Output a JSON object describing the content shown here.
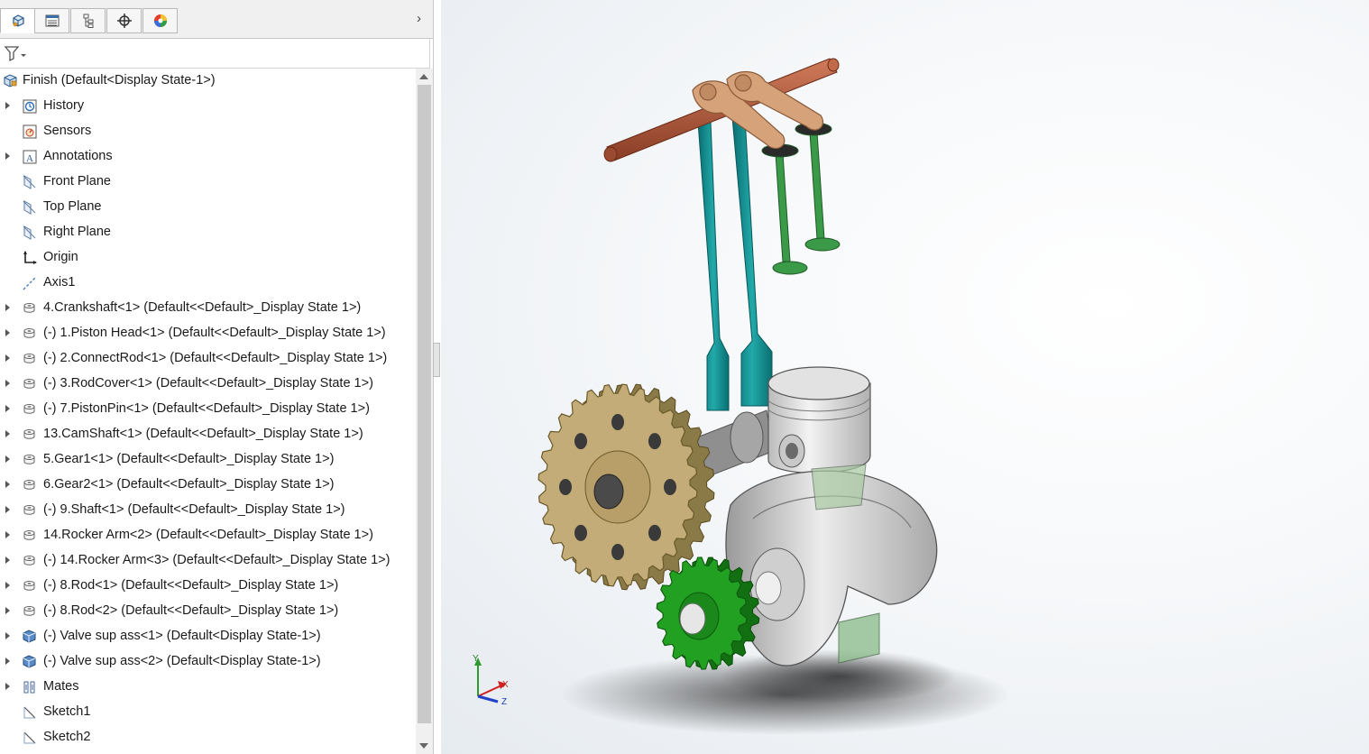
{
  "tabs": [
    {
      "name": "feature-manager",
      "icon": "part-cube-icon"
    },
    {
      "name": "property-manager",
      "icon": "list-icon"
    },
    {
      "name": "configuration-manager",
      "icon": "config-tree-icon"
    },
    {
      "name": "dimxpert-manager",
      "icon": "crosshair-icon"
    },
    {
      "name": "display-manager",
      "icon": "color-wheel-icon"
    }
  ],
  "filter": {
    "icon": "filter-icon"
  },
  "tree": {
    "root": {
      "label": "Finish  (Default<Display State-1>)",
      "icon": "assembly-icon"
    },
    "items": [
      {
        "label": "History",
        "icon": "history-icon",
        "expand": true
      },
      {
        "label": "Sensors",
        "icon": "sensor-icon",
        "expand": false
      },
      {
        "label": "Annotations",
        "icon": "annotation-icon",
        "expand": true
      },
      {
        "label": "Front Plane",
        "icon": "plane-icon",
        "expand": false
      },
      {
        "label": "Top Plane",
        "icon": "plane-icon",
        "expand": false
      },
      {
        "label": "Right Plane",
        "icon": "plane-icon",
        "expand": false
      },
      {
        "label": "Origin",
        "icon": "origin-icon",
        "expand": false
      },
      {
        "label": "Axis1",
        "icon": "axis-icon",
        "expand": false
      },
      {
        "label": "4.Crankshaft<1> (Default<<Default>_Display State 1>)",
        "icon": "part-icon",
        "expand": true
      },
      {
        "label": "(-) 1.Piston Head<1> (Default<<Default>_Display State 1>)",
        "icon": "part-icon",
        "expand": true
      },
      {
        "label": "(-) 2.ConnectRod<1> (Default<<Default>_Display State 1>)",
        "icon": "part-icon",
        "expand": true
      },
      {
        "label": "(-) 3.RodCover<1> (Default<<Default>_Display State 1>)",
        "icon": "part-icon",
        "expand": true
      },
      {
        "label": "(-) 7.PistonPin<1> (Default<<Default>_Display State 1>)",
        "icon": "part-icon",
        "expand": true
      },
      {
        "label": "13.CamShaft<1> (Default<<Default>_Display State 1>)",
        "icon": "part-icon",
        "expand": true
      },
      {
        "label": "5.Gear1<1> (Default<<Default>_Display State 1>)",
        "icon": "part-icon",
        "expand": true
      },
      {
        "label": "6.Gear2<1> (Default<<Default>_Display State 1>)",
        "icon": "part-icon",
        "expand": true
      },
      {
        "label": "(-) 9.Shaft<1> (Default<<Default>_Display State 1>)",
        "icon": "part-icon",
        "expand": true
      },
      {
        "label": "14.Rocker Arm<2> (Default<<Default>_Display State 1>)",
        "icon": "part-icon",
        "expand": true
      },
      {
        "label": "(-) 14.Rocker Arm<3> (Default<<Default>_Display State 1>)",
        "icon": "part-icon",
        "expand": true
      },
      {
        "label": "(-) 8.Rod<1> (Default<<Default>_Display State 1>)",
        "icon": "part-icon",
        "expand": true
      },
      {
        "label": "(-) 8.Rod<2> (Default<<Default>_Display State 1>)",
        "icon": "part-icon",
        "expand": true
      },
      {
        "label": "(-) Valve sup ass<1> (Default<Display State-1>)",
        "icon": "subassembly-icon",
        "expand": true
      },
      {
        "label": "(-) Valve sup ass<2> (Default<Display State-1>)",
        "icon": "subassembly-icon",
        "expand": true
      },
      {
        "label": "Mates",
        "icon": "mates-icon",
        "expand": true
      },
      {
        "label": "Sketch1",
        "icon": "sketch-icon",
        "expand": false
      },
      {
        "label": "Sketch2",
        "icon": "sketch-icon",
        "expand": false
      }
    ]
  },
  "triad": {
    "x": "X",
    "y": "Y",
    "z": "Z"
  },
  "colors": {
    "rod": "#0e8a8a",
    "valve": "#2d8a3a",
    "rocker": "#c8946a",
    "shaft": "#b05a3c",
    "gear_large": "#b8a06a",
    "gear_small": "#1f9a1f",
    "crank": "#c0c0c0"
  }
}
